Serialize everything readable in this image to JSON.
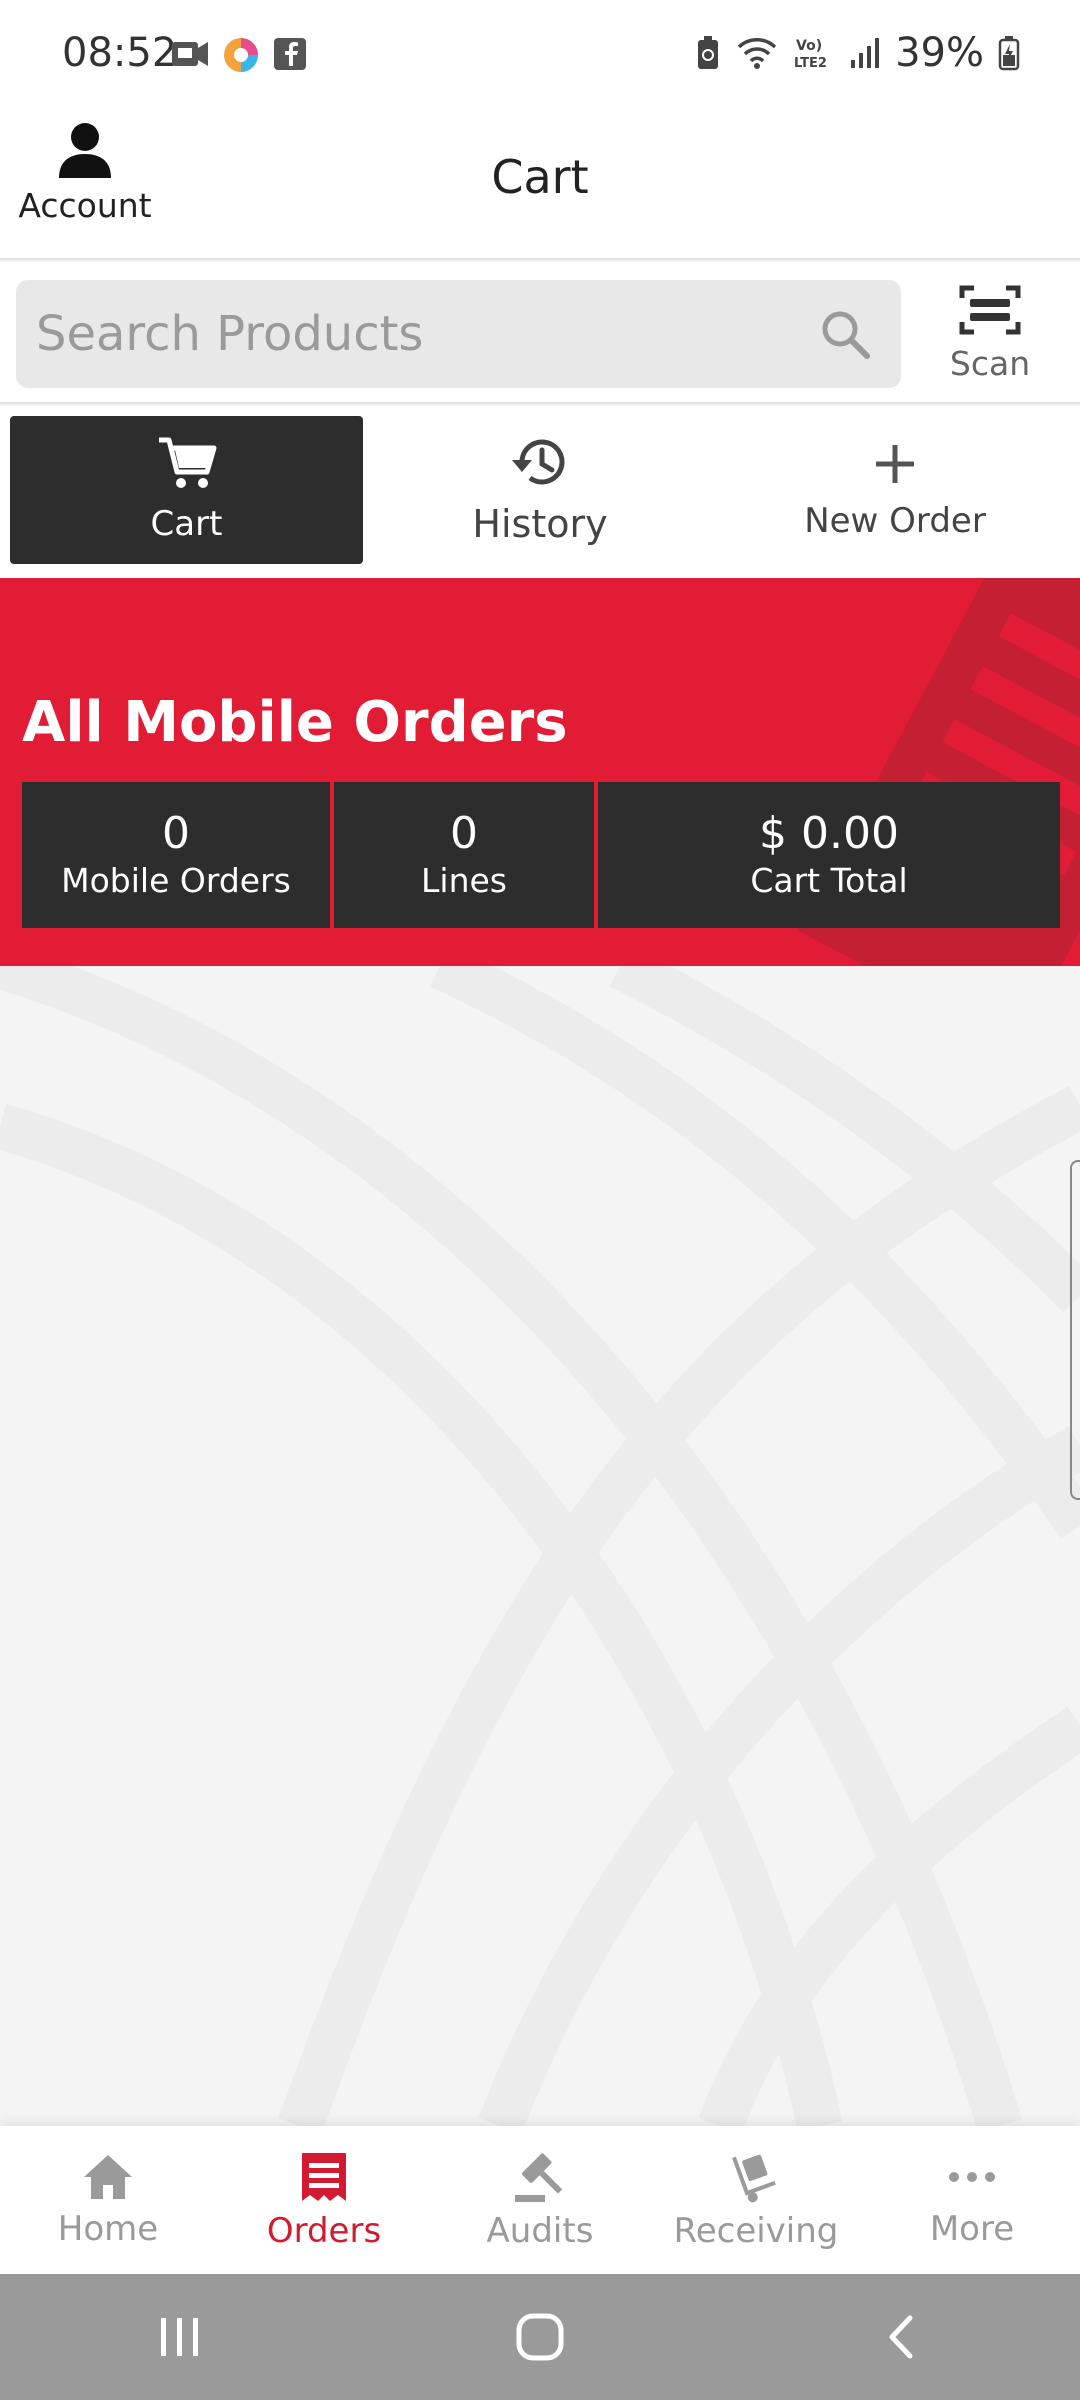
{
  "status_bar": {
    "time": "08:52",
    "battery": "39%",
    "icons_left": [
      "video-notification-icon",
      "app-notification-icon",
      "facebook-icon"
    ],
    "icons_right": [
      "battery-saver-icon",
      "wifi-icon",
      "volte-icon",
      "signal-icon",
      "battery-icon"
    ]
  },
  "header": {
    "account_label": "Account",
    "title": "Cart"
  },
  "search": {
    "placeholder": "Search Products",
    "value": "",
    "scan_label": "Scan"
  },
  "tabs": [
    {
      "label": "Cart",
      "icon": "cart-icon",
      "active": true
    },
    {
      "label": "History",
      "icon": "history-icon",
      "active": false
    },
    {
      "label": "New Order",
      "icon": "plus-icon",
      "active": false
    }
  ],
  "banner": {
    "title": "All Mobile Orders",
    "stats": [
      {
        "value": "0",
        "label": "Mobile Orders"
      },
      {
        "value": "0",
        "label": "Lines"
      },
      {
        "value": "$ 0.00",
        "label": "Cart Total"
      }
    ]
  },
  "bottom_nav": [
    {
      "label": "Home",
      "icon": "home-icon",
      "active": false
    },
    {
      "label": "Orders",
      "icon": "orders-icon",
      "active": true
    },
    {
      "label": "Audits",
      "icon": "gavel-icon",
      "active": false
    },
    {
      "label": "Receiving",
      "icon": "hand-truck-icon",
      "active": false
    },
    {
      "label": "More",
      "icon": "more-dots-icon",
      "active": false
    }
  ],
  "colors": {
    "brand_red": "#e31c36",
    "dark": "#2d2d2d",
    "active_nav": "#d21a30",
    "inactive_nav": "#9a9a9a"
  }
}
